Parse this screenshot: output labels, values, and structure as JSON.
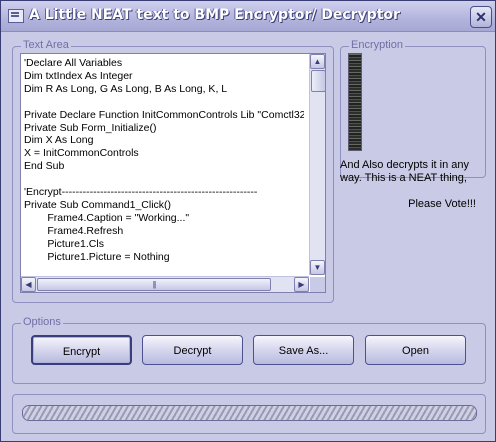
{
  "window": {
    "title": "A Little NEAT text to BMP Encryptor/ Decryptor",
    "close_glyph": "✕"
  },
  "text_area": {
    "label": "Text Area",
    "code": "'Declare All Variables\nDim txtIndex As Integer\nDim R As Long, G As Long, B As Long, K, L\n\nPrivate Declare Function InitCommonControls Lib \"Comctl32\nPrivate Sub Form_Initialize()\nDim X As Long\nX = InitCommonControls\nEnd Sub\n\n'Encrypt--------------------------------------------------------\nPrivate Sub Command1_Click()\n        Frame4.Caption = \"Working...\"\n        Frame4.Refresh\n        Picture1.Cls\n        Picture1.Picture = Nothing",
    "scroll_up": "▲",
    "scroll_down": "▼",
    "scroll_left": "◀",
    "scroll_right": "▶",
    "hthumb_grip": "|||"
  },
  "encryption": {
    "label": "Encryption",
    "description": "And Also decrypts it in any way. This is a NEAT thing,",
    "vote": "Please Vote!!!"
  },
  "options": {
    "label": "Options",
    "encrypt": "Encrypt",
    "decrypt": "Decrypt",
    "save_as": "Save As...",
    "open": "Open"
  },
  "progress": {
    "value": 1.0
  }
}
